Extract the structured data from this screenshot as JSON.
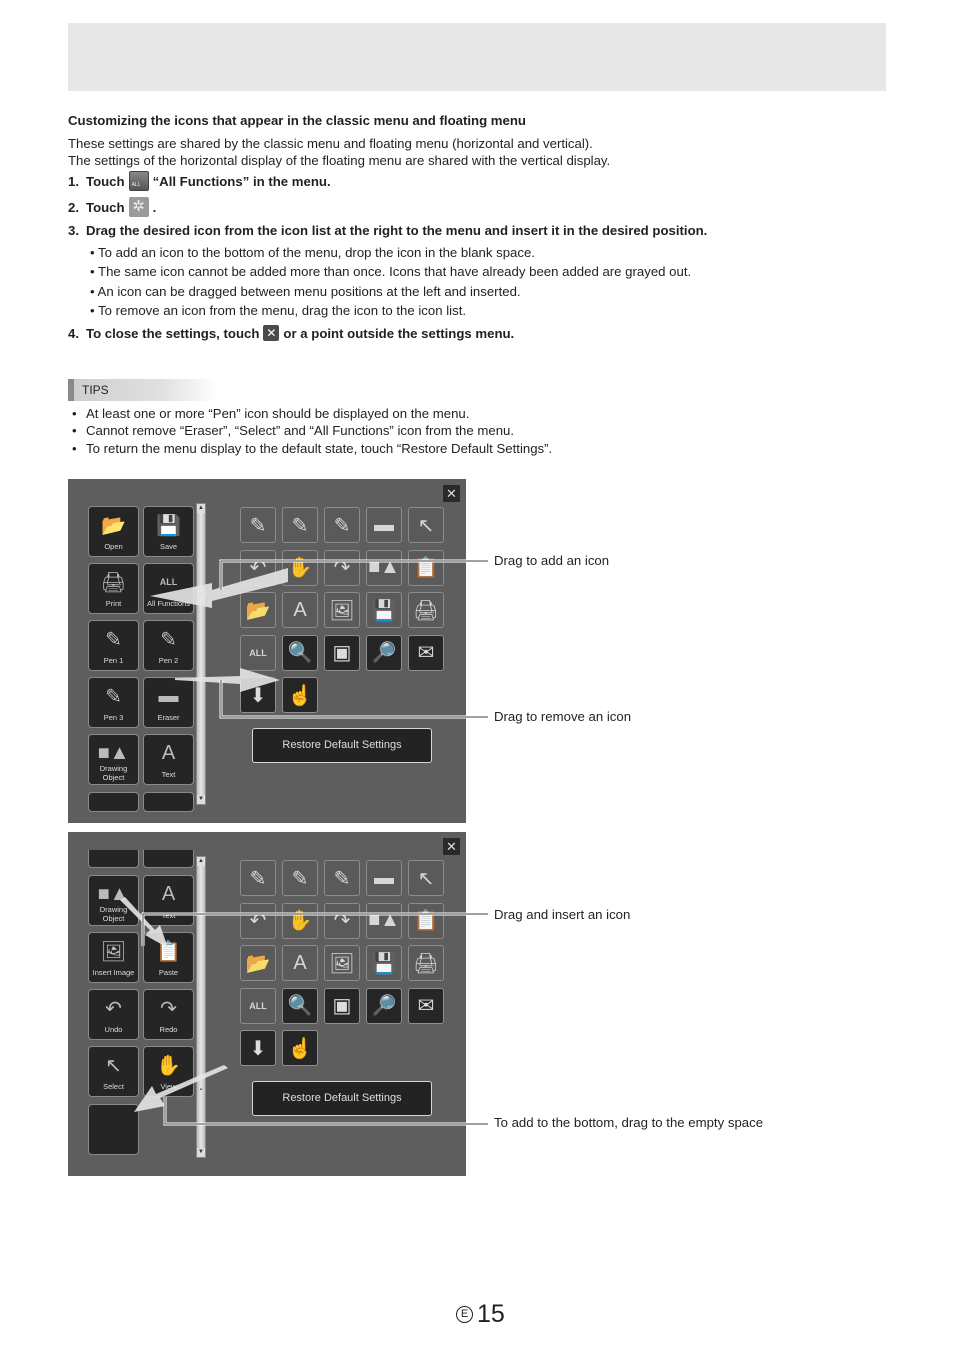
{
  "heading": "Customizing the icons that appear in the classic menu and floating menu",
  "intro": [
    "These settings are shared by the classic menu and floating menu (horizontal and vertical).",
    "The settings of the horizontal display of the floating menu are shared with the vertical display."
  ],
  "steps": [
    {
      "num": "1.",
      "before": "Touch",
      "icon": "all-functions-icon",
      "after": "“All Functions” in the menu."
    },
    {
      "num": "2.",
      "before": "Touch",
      "icon": "gear-icon",
      "after": "."
    },
    {
      "num": "3.",
      "text": "Drag the desired icon from the icon list at the right to the menu and insert it in the desired position."
    },
    {
      "num": "4.",
      "before": "To close the settings, touch",
      "icon": "close-icon",
      "after": "or a point outside the settings menu."
    }
  ],
  "step3_bullets": [
    "• To add an icon to the bottom of the menu, drop the icon in the blank space.",
    "• The same icon cannot be added more than once. Icons that have already been added are grayed out.",
    "• An icon can be dragged between menu positions at the left and inserted.",
    "• To remove an icon from the menu, drag the icon to the icon list."
  ],
  "tips": {
    "label": "TIPS",
    "items": [
      "At least one or more “Pen” icon should be displayed on the menu.",
      "Cannot remove “Eraser”, “Select” and “All Functions” icon from the menu.",
      "To return the menu display to the default state, touch “Restore Default Settings”."
    ]
  },
  "panel1": {
    "close": "✕",
    "menu_tiles": [
      {
        "label": "Open",
        "icon": "📂"
      },
      {
        "label": "Save",
        "icon": "💾"
      },
      {
        "label": "Print",
        "icon": "🖨"
      },
      {
        "label": "All Functions",
        "icon": "ALL"
      },
      {
        "label": "Pen 1",
        "icon": "✎"
      },
      {
        "label": "Pen 2",
        "icon": "✎"
      },
      {
        "label": "Pen 3",
        "icon": "✎"
      },
      {
        "label": "Eraser",
        "icon": "▬"
      },
      {
        "label": "Drawing Object",
        "icon": "■▲"
      },
      {
        "label": "Text",
        "icon": "A"
      }
    ],
    "restore_label": "Restore Default Settings"
  },
  "panel2": {
    "close": "✕",
    "menu_tiles": [
      {
        "label": "Drawing Object",
        "icon": "■▲"
      },
      {
        "label": "Text",
        "icon": "A"
      },
      {
        "label": "Insert Image",
        "icon": "🖼"
      },
      {
        "label": "Paste",
        "icon": "📋"
      },
      {
        "label": "Undo",
        "icon": "↶"
      },
      {
        "label": "Redo",
        "icon": "↷"
      },
      {
        "label": "Select",
        "icon": "↖"
      },
      {
        "label": "View",
        "icon": "✋"
      }
    ],
    "restore_label": "Restore Default Settings"
  },
  "icon_list": [
    {
      "name": "pen-1",
      "glyph": "✎",
      "state": "grayed"
    },
    {
      "name": "pen-2",
      "glyph": "✎",
      "state": "grayed"
    },
    {
      "name": "pen-3",
      "glyph": "✎",
      "state": "grayed"
    },
    {
      "name": "eraser",
      "glyph": "▬",
      "state": "grayed"
    },
    {
      "name": "select",
      "glyph": "↖",
      "state": "grayed"
    },
    {
      "name": "undo",
      "glyph": "↶",
      "state": "grayed"
    },
    {
      "name": "view",
      "glyph": "✋",
      "state": "grayed"
    },
    {
      "name": "redo",
      "glyph": "↷",
      "state": "grayed"
    },
    {
      "name": "drawing-object",
      "glyph": "■▲",
      "state": "grayed"
    },
    {
      "name": "paste",
      "glyph": "📋",
      "state": "grayed"
    },
    {
      "name": "open",
      "glyph": "📂",
      "state": "grayed"
    },
    {
      "name": "text",
      "glyph": "A",
      "state": "grayed"
    },
    {
      "name": "insert-image",
      "glyph": "🖼",
      "state": "grayed"
    },
    {
      "name": "save",
      "glyph": "💾",
      "state": "grayed"
    },
    {
      "name": "print",
      "glyph": "🖨",
      "state": "grayed"
    },
    {
      "name": "all-functions",
      "glyph": "ALL",
      "state": "grayed"
    },
    {
      "name": "zoom",
      "glyph": "🔍",
      "state": "available"
    },
    {
      "name": "screen-capture",
      "glyph": "▣",
      "state": "available"
    },
    {
      "name": "search",
      "glyph": "🔎",
      "state": "available"
    },
    {
      "name": "send",
      "glyph": "✉",
      "state": "available"
    },
    {
      "name": "import",
      "glyph": "⬇",
      "state": "available"
    },
    {
      "name": "touch-pen-mode",
      "glyph": "☝",
      "state": "available"
    }
  ],
  "callouts": {
    "add": "Drag to add an icon",
    "remove": "Drag to remove an icon",
    "insert": "Drag and insert an icon",
    "bottom": "To add to the bottom, drag to the empty space"
  },
  "page": {
    "lang_mark": "E",
    "number": "15"
  }
}
